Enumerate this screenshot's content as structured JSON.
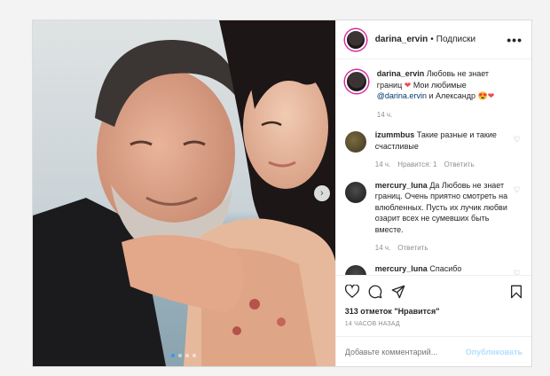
{
  "header": {
    "username": "darina_ervin",
    "separator": "•",
    "follow_label": "Подписки",
    "more_icon": "more-dots-icon"
  },
  "caption": {
    "username": "darina_ervin",
    "text_part1": "Любовь не знает границ",
    "heart1": "❤",
    "text_part2": "Мои любимые",
    "mention": "@darina.ervin",
    "text_part3": "и Александр",
    "emoji": "😍❤",
    "time": "14 ч."
  },
  "comments": [
    {
      "username": "izummbus",
      "text": "Такие разные и такие счастливые",
      "time": "14 ч.",
      "likes": "Нравится: 1",
      "reply": "Ответить"
    },
    {
      "username": "mercury_luna",
      "text": "Да Любовь не знает границ. Очень приятно смотреть на влюбленных. Пусть их лучик любви озарит всех не сумевших быть вместе.",
      "time": "14 ч.",
      "reply": "Ответить"
    },
    {
      "username": "mercury_luna",
      "text": "Спасибо"
    }
  ],
  "actions": {
    "like_icon": "heart-outline-icon",
    "comment_icon": "comment-icon",
    "share_icon": "share-icon",
    "save_icon": "bookmark-icon"
  },
  "likes_count": "313 отметок \"Нравится\"",
  "posted_time": "14 часов назад",
  "add_comment": {
    "placeholder": "Добавьте комментарий...",
    "publish_label": "Опубликовать"
  },
  "carousel": {
    "total": 4,
    "active_index": 0
  }
}
